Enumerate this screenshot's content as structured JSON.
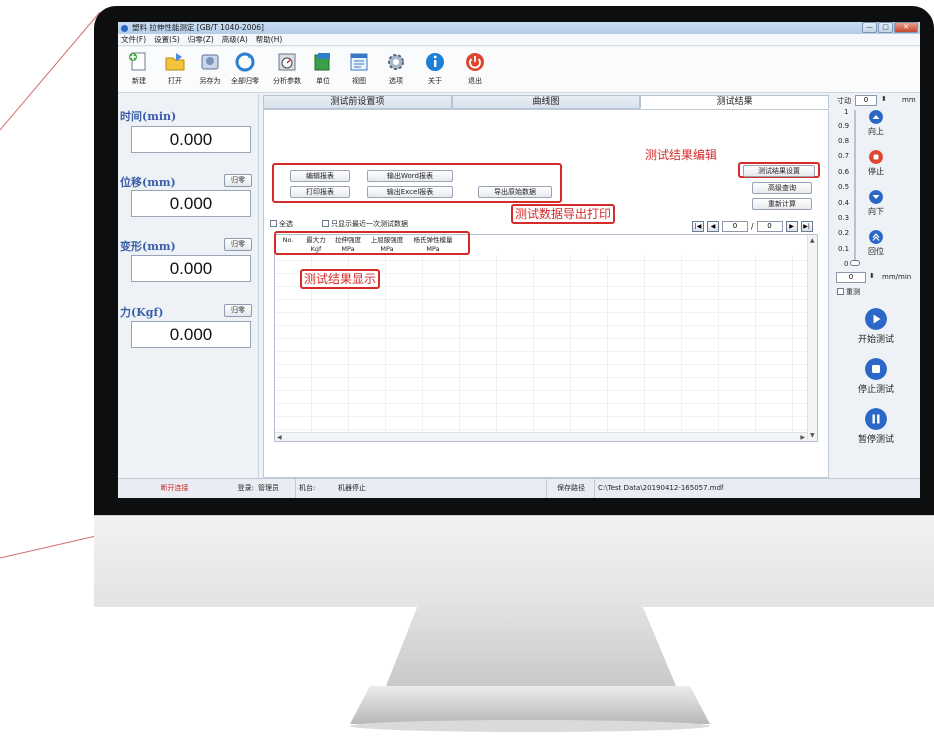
{
  "window": {
    "title": "塑料 拉伸性能测定 [GB/T 1040-2006]",
    "buttons": {
      "minimize": "—",
      "maximize": "□",
      "close": "✕"
    }
  },
  "menu": [
    "文件(F)",
    "设置(S)",
    "归零(Z)",
    "高级(A)",
    "帮助(H)"
  ],
  "toolbar": [
    {
      "label": "新建",
      "icon": "new-file-icon"
    },
    {
      "label": "打开",
      "icon": "open-folder-icon"
    },
    {
      "label": "另存为",
      "icon": "save-as-icon"
    },
    {
      "label": "全部归零",
      "icon": "reset-all-icon"
    },
    {
      "label": "分析参数",
      "icon": "gauge-icon"
    },
    {
      "label": "单位",
      "icon": "unit-icon"
    },
    {
      "label": "视图",
      "icon": "view-icon"
    },
    {
      "label": "选项",
      "icon": "options-gear-icon"
    },
    {
      "label": "关于",
      "icon": "info-icon"
    },
    {
      "label": "退出",
      "icon": "power-icon"
    }
  ],
  "measurements": [
    {
      "label": "时间(min)",
      "value": "0.000",
      "zero": ""
    },
    {
      "label": "位移(mm)",
      "value": "0.000",
      "zero": "归零"
    },
    {
      "label": "变形(mm)",
      "value": "0.000",
      "zero": "归零"
    },
    {
      "label": "力(Kgf)",
      "value": "0.000",
      "zero": "归零"
    }
  ],
  "tabs": [
    "测试前设置项",
    "曲线图",
    "测试结果"
  ],
  "active_tab": "测试结果",
  "report_buttons": {
    "edit_report": "编辑报表",
    "export_word": "输出Word报表",
    "print_report": "打印报表",
    "export_excel": "输出Excel报表",
    "export_raw": "导出原始数据"
  },
  "result_buttons": {
    "result_settings": "测试结果设置",
    "advanced_query": "高级查询",
    "recalculate": "重新计算"
  },
  "checkboxes": {
    "select_all": "全选",
    "only_latest": "只显示最近一次测试数据"
  },
  "pager": {
    "current": "0",
    "separator": "/",
    "total": "0"
  },
  "table": {
    "columns": [
      {
        "top": "No.",
        "unit": ""
      },
      {
        "top": "最大力",
        "unit": "Kgf"
      },
      {
        "top": "拉伸强度",
        "unit": "MPa"
      },
      {
        "top": "上屈服强度",
        "unit": "MPa"
      },
      {
        "top": "杨氏弹性模量",
        "unit": "MPa"
      }
    ]
  },
  "annotations": {
    "result_edit": "测试结果编辑",
    "export_print": "测试数据导出打印",
    "result_display": "测试结果显示"
  },
  "jog": {
    "label": "寸动",
    "value": "0",
    "unit": "mm",
    "scale": [
      "1",
      "0.9",
      "0.8",
      "0.7",
      "0.6",
      "0.5",
      "0.4",
      "0.3",
      "0.2",
      "0.1",
      "0"
    ],
    "up": "向上",
    "stop": "停止",
    "down": "向下",
    "return": "回位"
  },
  "speed": {
    "value": "0",
    "unit": "mm/min"
  },
  "reset_check": "重测",
  "controls": {
    "start": "开始测试",
    "stop": "停止测试",
    "pause": "暂停测试"
  },
  "status": {
    "connection": "断开连接",
    "login_label": "登录:",
    "login_user": "管理员",
    "machine_label": "机台:",
    "machine_state": "机器停止",
    "save_path_label": "保存路径",
    "save_path": "C:\\Test Data\\20190412-165057.mdf"
  },
  "colors": {
    "accent_blue": "#2a67c7",
    "annotation_red": "#d62b2b",
    "label_blue": "#3a5ea8",
    "status_red": "#c62828"
  }
}
